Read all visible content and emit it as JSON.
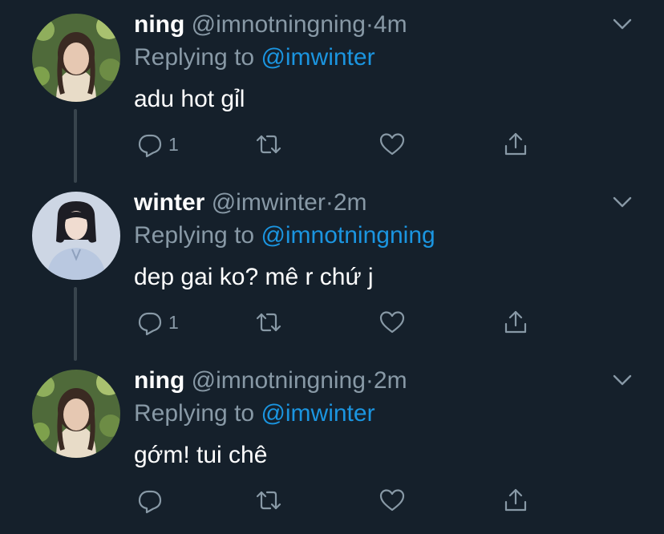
{
  "colors": {
    "background": "#15202b",
    "primary_text": "#ffffff",
    "secondary_text": "#8899a6",
    "link": "#1b95e0",
    "thread_line": "#38444d"
  },
  "icons": [
    "chevron-down-icon",
    "reply-icon",
    "retweet-icon",
    "like-icon",
    "share-icon"
  ],
  "tweets": [
    {
      "name": "ning",
      "handle": "@imnotningning",
      "separator": "·",
      "time": "4m",
      "replying_prefix": "Replying to",
      "replying_to": "@imwinter",
      "text": "adu hot gỉl",
      "reply_count": "1"
    },
    {
      "name": "winter",
      "handle": "@imwinter",
      "separator": "·",
      "time": "2m",
      "replying_prefix": "Replying to",
      "replying_to": "@imnotningning",
      "text": "dep gai ko? mê r chứ j",
      "reply_count": "1"
    },
    {
      "name": "ning",
      "handle": "@imnotningning",
      "separator": "·",
      "time": "2m",
      "replying_prefix": "Replying to",
      "replying_to": "@imwinter",
      "text": "gớm! tui chê",
      "reply_count": ""
    }
  ]
}
